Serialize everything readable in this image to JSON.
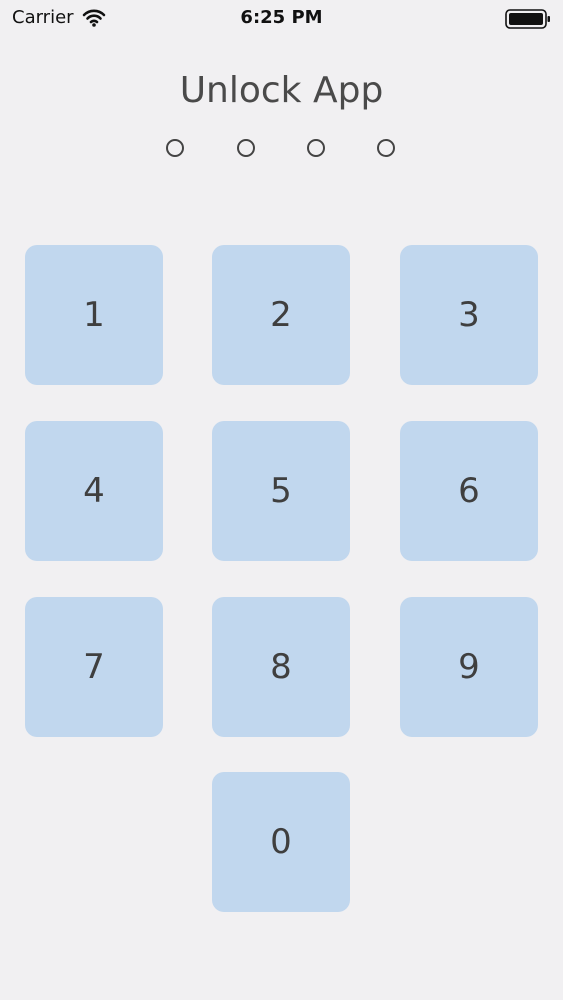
{
  "status_bar": {
    "carrier": "Carrier",
    "time": "6:25 PM",
    "icons": [
      "wifi-icon",
      "battery-icon"
    ]
  },
  "title": "Unlock App",
  "pin": {
    "length": 4,
    "entered": 0
  },
  "keypad": {
    "keys": [
      "1",
      "2",
      "3",
      "4",
      "5",
      "6",
      "7",
      "8",
      "9",
      "0"
    ]
  },
  "colors": {
    "background": "#f1f0f2",
    "key_fill": "#c1d7ee",
    "key_text": "#3f3f3f",
    "title_text": "#4a4a4a"
  }
}
